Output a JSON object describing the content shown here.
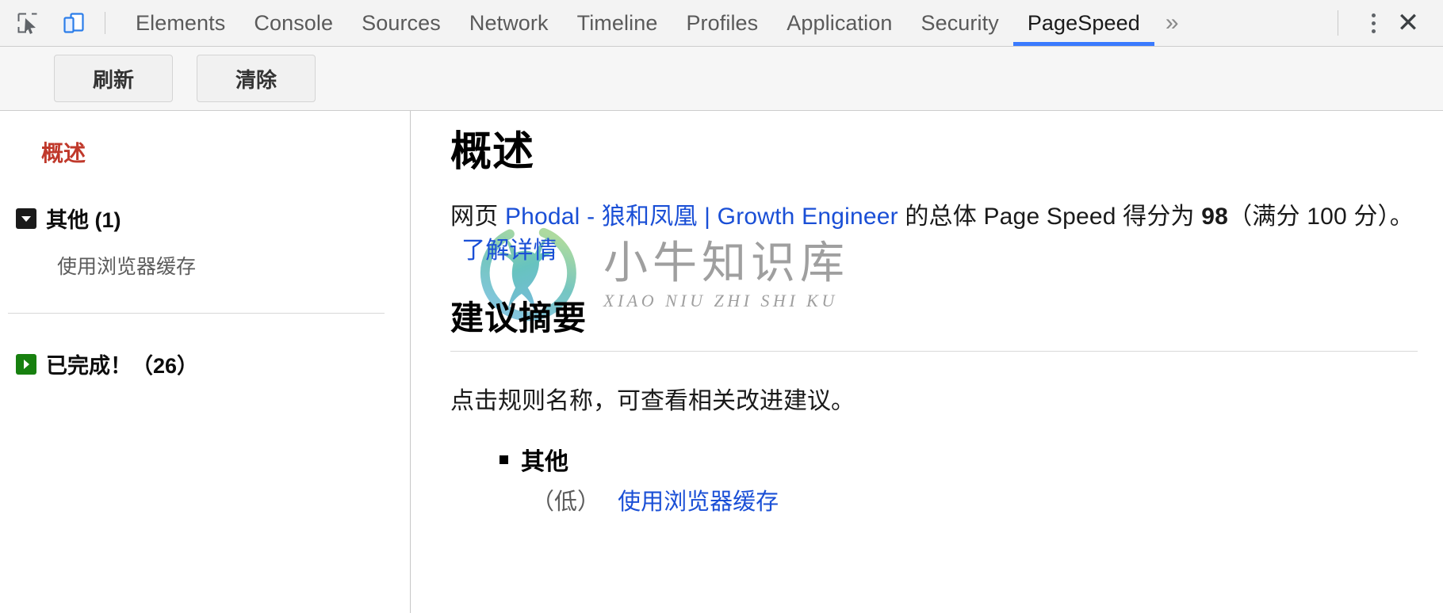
{
  "toolbar": {
    "inspect_icon": "inspect-cursor-icon",
    "device_icon": "device-toolbar-icon",
    "tabs": [
      {
        "label": "Elements",
        "active": false
      },
      {
        "label": "Console",
        "active": false
      },
      {
        "label": "Sources",
        "active": false
      },
      {
        "label": "Network",
        "active": false
      },
      {
        "label": "Timeline",
        "active": false
      },
      {
        "label": "Profiles",
        "active": false
      },
      {
        "label": "Application",
        "active": false
      },
      {
        "label": "Security",
        "active": false
      },
      {
        "label": "PageSpeed",
        "active": true
      }
    ],
    "more_tabs_label": "»",
    "menu_icon": "kebab-menu-icon",
    "close_icon": "close-icon",
    "active_tab_color": "#3a7afe"
  },
  "action_bar": {
    "refresh_label": "刷新",
    "clear_label": "清除"
  },
  "sidebar": {
    "overview_label": "概述",
    "overview_color": "#c0392b",
    "groups": [
      {
        "label": "其他 (1)",
        "expanded": true,
        "marker_color": "#1a1a1a",
        "items": [
          "使用浏览器缓存"
        ]
      },
      {
        "label": "已完成！（26）",
        "expanded": false,
        "marker_color": "#17800f",
        "items": []
      }
    ]
  },
  "main": {
    "title": "概述",
    "summary": {
      "prefix": "网页 ",
      "page_link": "Phodal - 狼和凤凰 | Growth Engineer",
      "middle": " 的总体 Page Speed 得分为 ",
      "score": "98",
      "suffix": "（满分 100 分）。",
      "learn_more_link": "了解详情"
    },
    "section_title": "建议摘要",
    "hint": "点击规则名称，可查看相关改进建议。",
    "rules": [
      {
        "category": "其他",
        "items": [
          {
            "priority": "（低）",
            "name": "使用浏览器缓存"
          }
        ]
      }
    ],
    "link_color": "#1a4fd6"
  },
  "watermark": {
    "cn": "小牛知识库",
    "en": "XIAO NIU ZHI SHI KU",
    "logo_icon": "deer-logo-icon"
  }
}
